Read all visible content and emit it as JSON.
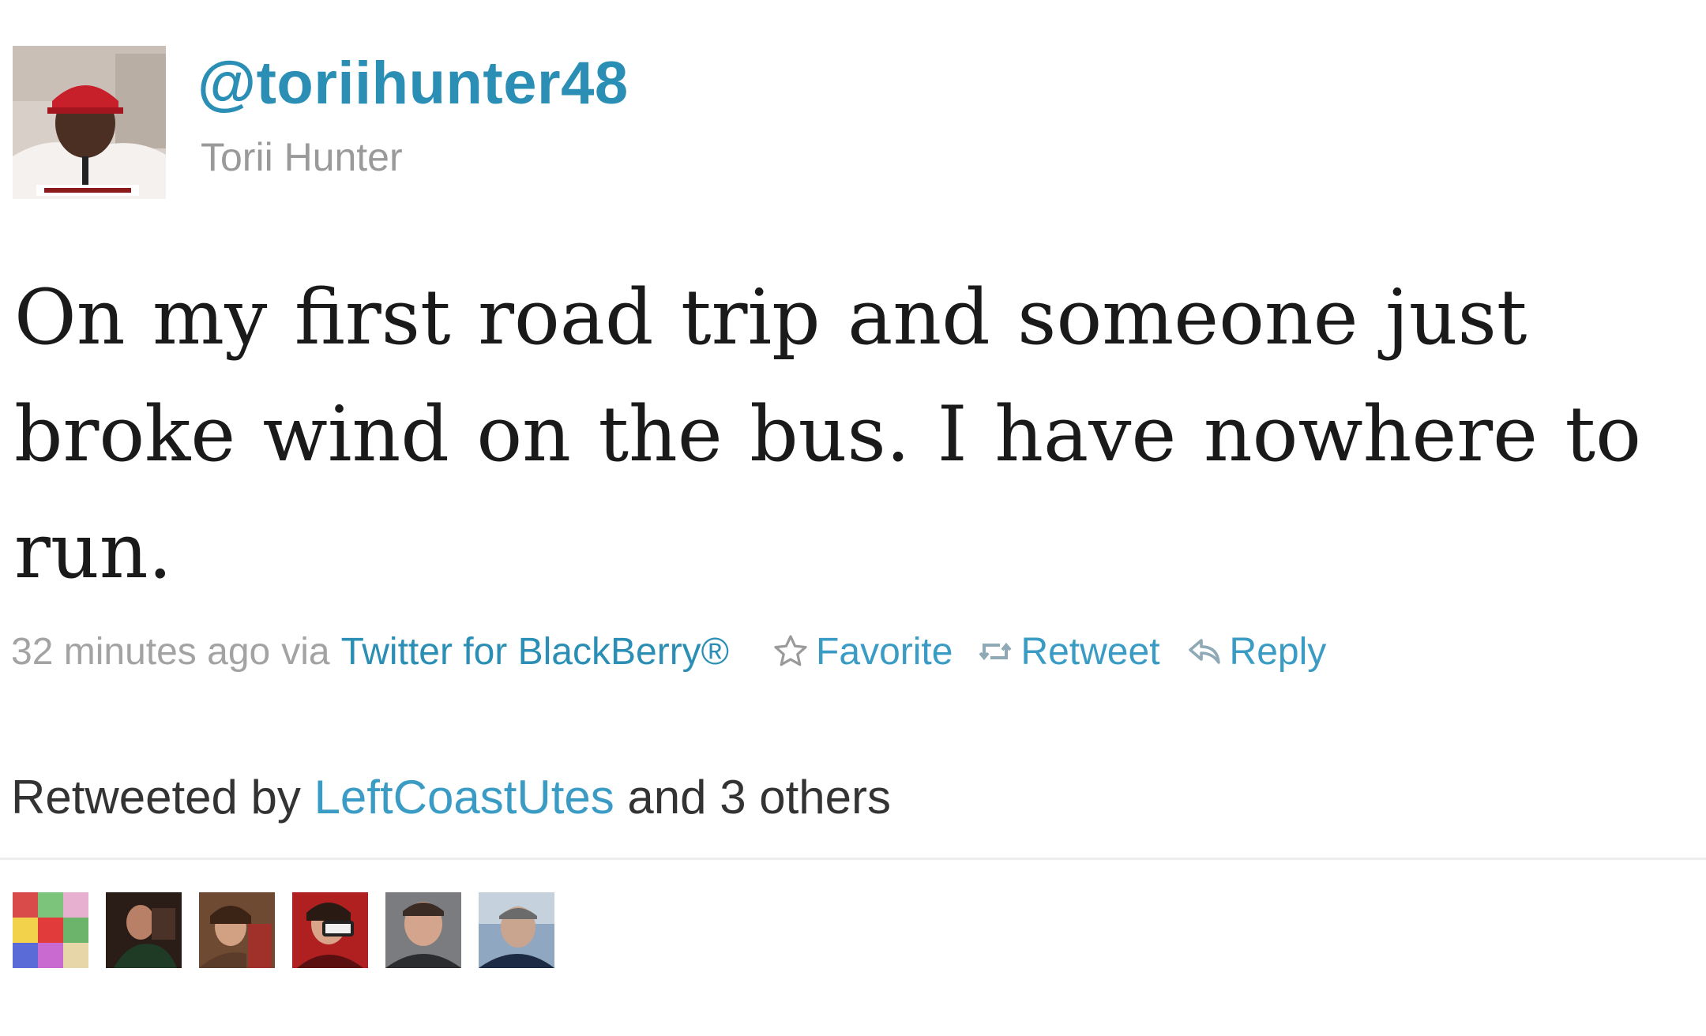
{
  "tweet": {
    "handle": "@toriihunter48",
    "name": "Torii Hunter",
    "text": "On my first road trip and someone just broke wind on the bus. I have nowhere to run.",
    "time": "32 minutes ago",
    "via": "via",
    "source": "Twitter for BlackBerry®"
  },
  "actions": {
    "favorite": "Favorite",
    "retweet": "Retweet",
    "reply": "Reply"
  },
  "retweeted": {
    "prefix": "Retweeted by",
    "user": "LeftCoastUtes",
    "suffix": "and 3 others"
  },
  "colors": {
    "link": "#2b8fb5",
    "meta_gray": "#a3a3a3",
    "text": "#1a1a1a"
  },
  "icons": {
    "favorite": "star-outline-icon",
    "retweet": "retweet-arrows-icon",
    "reply": "reply-arrow-icon"
  }
}
